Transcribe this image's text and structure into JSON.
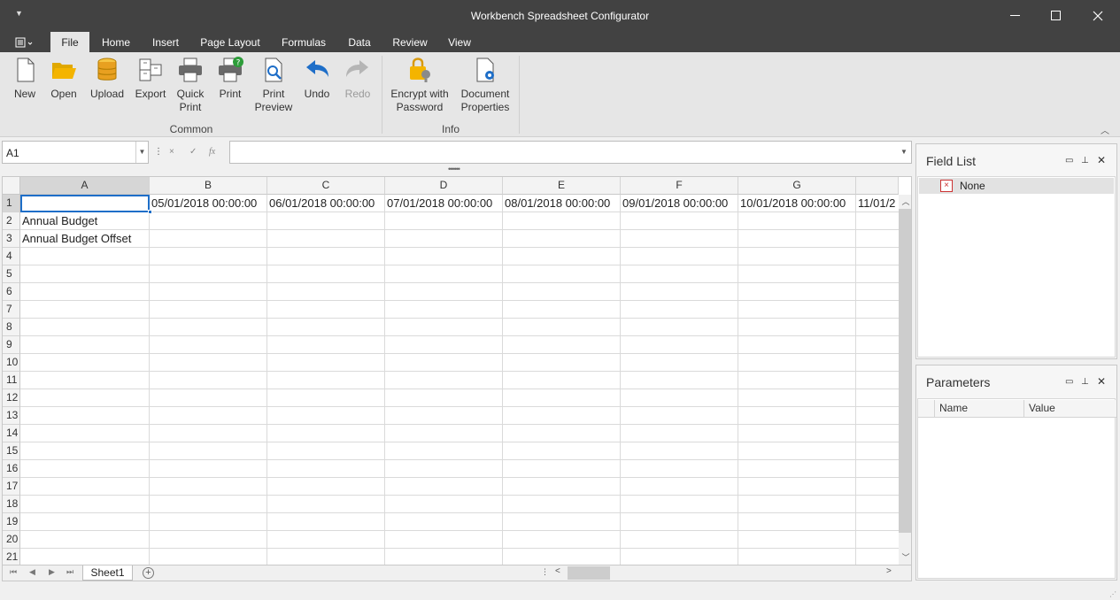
{
  "window": {
    "title": "Workbench Spreadsheet Configurator",
    "qat_icon": "customize-quick-access-toolbar-arrow",
    "minimize_icon": "minimize-icon",
    "maximize_icon": "maximize-icon",
    "close_icon": "close-icon"
  },
  "tabs": [
    "File",
    "Home",
    "Insert",
    "Page Layout",
    "Formulas",
    "Data",
    "Review",
    "View"
  ],
  "active_tab": "File",
  "ribbon": {
    "groups": {
      "common": "Common",
      "info": "Info"
    },
    "buttons": {
      "new": [
        "New"
      ],
      "open": [
        "Open"
      ],
      "upload": [
        "Upload"
      ],
      "export": [
        "Export"
      ],
      "quick_print": [
        "Quick",
        "Print"
      ],
      "print": [
        "Print"
      ],
      "print_preview": [
        "Print",
        "Preview"
      ],
      "undo": [
        "Undo"
      ],
      "redo": [
        "Redo"
      ],
      "encrypt": [
        "Encrypt with",
        "Password"
      ],
      "doc_props": [
        "Document",
        "Properties"
      ]
    }
  },
  "formula_bar": {
    "name_box": "A1",
    "cancel_glyph": "×",
    "enter_glyph": "✓",
    "fx_glyph": "fx",
    "value": ""
  },
  "sheet": {
    "columns": [
      "A",
      "B",
      "C",
      "D",
      "E",
      "F",
      "G"
    ],
    "rows": [
      "1",
      "2",
      "3",
      "4",
      "5",
      "6",
      "7",
      "8",
      "9",
      "10",
      "11",
      "12",
      "13",
      "14",
      "15",
      "16",
      "17",
      "18",
      "19",
      "20",
      "21"
    ],
    "cells": {
      "b1": "05/01/2018 00:00:00",
      "c1": "06/01/2018 00:00:00",
      "d1": "07/01/2018 00:00:00",
      "e1": "08/01/2018 00:00:00",
      "f1": "09/01/2018 00:00:00",
      "g1": "10/01/2018 00:00:00",
      "h1": "11/01/2",
      "a2": "Annual Budget",
      "a3": "Annual Budget Offset"
    },
    "active_sheet": "Sheet1"
  },
  "field_list": {
    "title": "Field List",
    "items": [
      "None"
    ]
  },
  "parameters": {
    "title": "Parameters",
    "columns": [
      "Name",
      "Value"
    ]
  },
  "colors": {
    "titlebar": "#424242",
    "ribbon": "#e6e6e6",
    "selection": "#1e6ec8",
    "undo_blue": "#1e6ec8",
    "folder_yellow": "#f4b400"
  }
}
